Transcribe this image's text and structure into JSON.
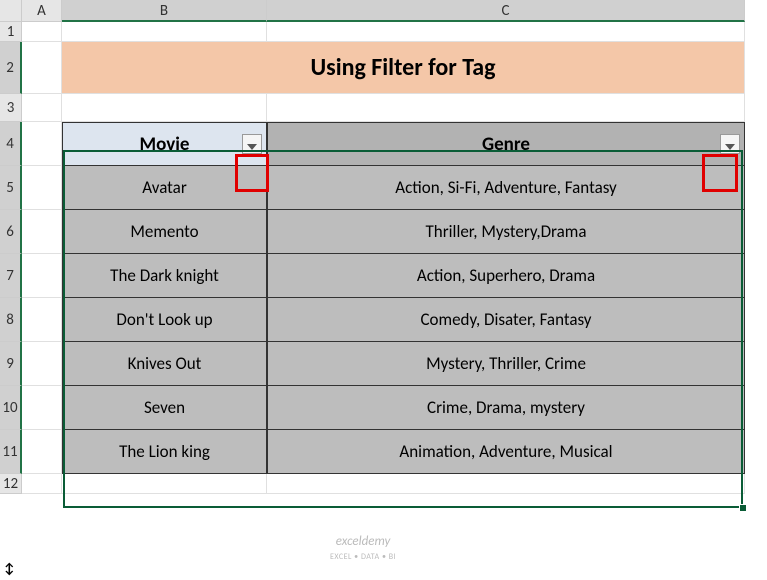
{
  "columns": {
    "a": "A",
    "b": "B",
    "c": "C"
  },
  "rows": [
    "1",
    "2",
    "3",
    "4",
    "5",
    "6",
    "7",
    "8",
    "9",
    "10",
    "11",
    "12"
  ],
  "title": "Using Filter for Tag",
  "headers": {
    "movie": "Movie",
    "genre": "Genre"
  },
  "table": [
    {
      "movie": "Avatar",
      "genre": "Action, Si-Fi, Adventure, Fantasy"
    },
    {
      "movie": "Memento",
      "genre": "Thriller, Mystery,Drama"
    },
    {
      "movie": "The Dark knight",
      "genre": "Action, Superhero, Drama"
    },
    {
      "movie": "Don't Look up",
      "genre": "Comedy, Disater, Fantasy"
    },
    {
      "movie": "Knives Out",
      "genre": "Mystery, Thriller, Crime"
    },
    {
      "movie": "Seven",
      "genre": "Crime, Drama, mystery"
    },
    {
      "movie": "The Lion king",
      "genre": "Animation, Adventure, Musical"
    }
  ],
  "watermark": {
    "main": "exceldemy",
    "sub": "EXCEL • DATA • BI"
  },
  "chart_data": {
    "type": "table",
    "title": "Using Filter for Tag",
    "columns": [
      "Movie",
      "Genre"
    ],
    "rows": [
      [
        "Avatar",
        "Action, Si-Fi, Adventure, Fantasy"
      ],
      [
        "Memento",
        "Thriller, Mystery,Drama"
      ],
      [
        "The Dark knight",
        "Action, Superhero, Drama"
      ],
      [
        "Don't Look up",
        "Comedy, Disater, Fantasy"
      ],
      [
        "Knives Out",
        "Mystery, Thriller, Crime"
      ],
      [
        "Seven",
        "Crime, Drama, mystery"
      ],
      [
        "The Lion king",
        "Animation, Adventure, Musical"
      ]
    ]
  }
}
